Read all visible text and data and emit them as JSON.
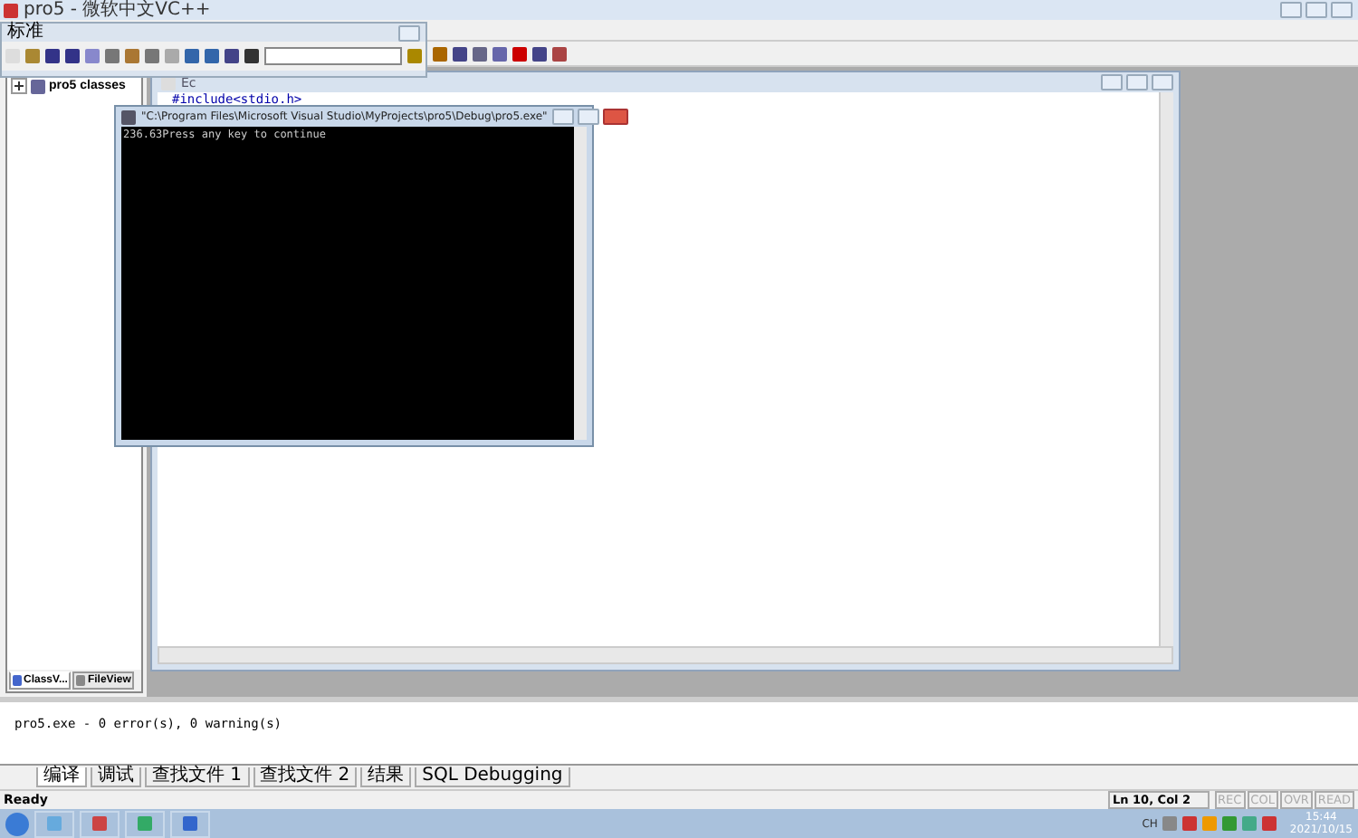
{
  "window": {
    "title": "pro5 - 微软中文VC++"
  },
  "floating_toolbar": {
    "title": "标准"
  },
  "class_view": {
    "tree": [
      {
        "label": "pro5 classes",
        "expanded": false
      }
    ],
    "tabs": [
      {
        "label": "ClassV...",
        "selected": true
      },
      {
        "label": "FileView",
        "selected": false
      }
    ]
  },
  "editor": {
    "title": "Ec",
    "lines": [
      "#include<stdio.h>"
    ]
  },
  "console": {
    "title": "\"C:\\Program Files\\Microsoft Visual Studio\\MyProjects\\pro5\\Debug\\pro5.exe\"",
    "lines": [
      "236.63Press any key to continue"
    ]
  },
  "output": {
    "lines": [
      "pro5.exe - 0 error(s), 0 warning(s)"
    ],
    "tabs": [
      {
        "label": "编译",
        "selected": true
      },
      {
        "label": "调试",
        "selected": false
      },
      {
        "label": "查找文件 1",
        "selected": false
      },
      {
        "label": "查找文件 2",
        "selected": false
      },
      {
        "label": "结果",
        "selected": false
      },
      {
        "label": "SQL Debugging",
        "selected": false
      }
    ]
  },
  "status_bar": {
    "message": "Ready",
    "position": "Ln 10, Col 2",
    "indicators": [
      {
        "label": "REC",
        "disabled": true
      },
      {
        "label": "COL",
        "disabled": true
      },
      {
        "label": "OVR",
        "disabled": true
      },
      {
        "label": "READ",
        "disabled": true
      }
    ]
  },
  "taskbar": {
    "language": "CH",
    "time": "15:44",
    "date": "2021/10/15"
  }
}
